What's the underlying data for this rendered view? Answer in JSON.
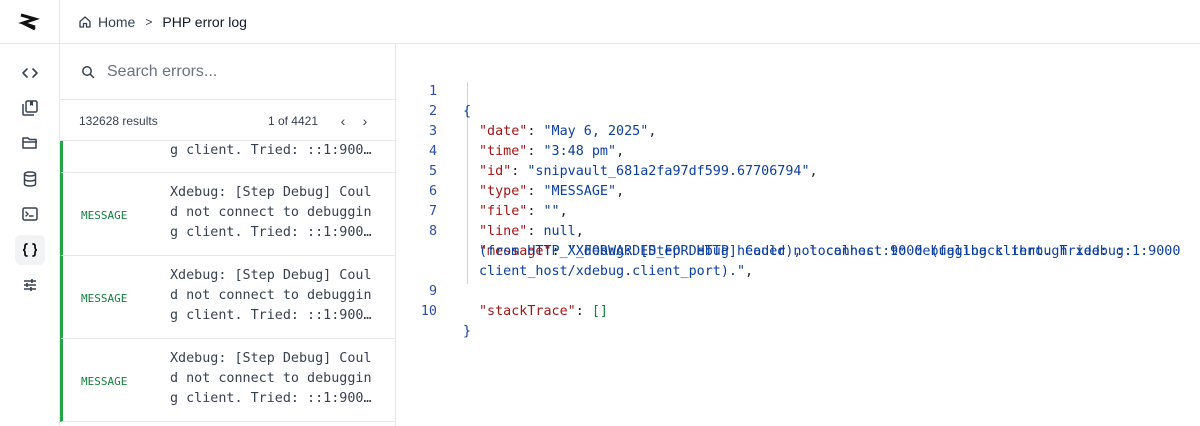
{
  "breadcrumb": {
    "home_label": "Home",
    "separator": ">",
    "current_label": "PHP error log"
  },
  "search": {
    "placeholder": "Search errors..."
  },
  "results": {
    "count_text": "132628 results",
    "page_text": "1 of 4421",
    "prev_symbol": "‹",
    "next_symbol": "›"
  },
  "list": {
    "partial_row": {
      "message_tail": "g client. Tried: ::1:900…"
    },
    "rows": [
      {
        "type": "MESSAGE",
        "line1": "Xdebug: [Step Debug] Coul",
        "line2": "d not connect to debuggin",
        "line3": "g client. Tried: ::1:900…"
      },
      {
        "type": "MESSAGE",
        "line1": "Xdebug: [Step Debug] Coul",
        "line2": "d not connect to debuggin",
        "line3": "g client. Tried: ::1:900…"
      },
      {
        "type": "MESSAGE",
        "line1": "Xdebug: [Step Debug] Coul",
        "line2": "d not connect to debuggin",
        "line3": "g client. Tried: ::1:900…"
      }
    ]
  },
  "viewer": {
    "lines": [
      {
        "num": "1",
        "open": "{"
      },
      {
        "num": "2",
        "key": "\"date\"",
        "value": "\"May 6, 2025\""
      },
      {
        "num": "3",
        "key": "\"time\"",
        "value": "\"3:48 pm\""
      },
      {
        "num": "4",
        "key": "\"id\"",
        "value": "\"snipvault_681a2fa97df599.67706794\""
      },
      {
        "num": "5",
        "key": "\"type\"",
        "value": "\"MESSAGE\""
      },
      {
        "num": "6",
        "key": "\"file\"",
        "value": "\"\""
      },
      {
        "num": "7",
        "key": "\"line\"",
        "value": "null"
      },
      {
        "num": "8",
        "key": "\"message\"",
        "value": "\"Xdebug: [Step Debug] Could not connect to debugging client. Tried: ::1:9000",
        "cont1": "(from HTTP_X_FORWARDED_FOR HTTP header), localhost:9000 (fallback through xdebug.",
        "cont2": "client_host/xdebug.client_port).\""
      },
      {
        "num": "9",
        "key": "\"stackTrace\"",
        "value": "[]"
      },
      {
        "num": "10",
        "close": "}"
      }
    ]
  },
  "colors": {
    "accent_green": "#22a447",
    "json_key": "#a31515",
    "json_string": "#0b3fa0"
  },
  "icons": [
    "logo-icon",
    "code-icon",
    "library-icon",
    "folder-icon",
    "database-icon",
    "terminal-icon",
    "braces-icon",
    "sliders-icon",
    "home-icon",
    "search-icon"
  ]
}
